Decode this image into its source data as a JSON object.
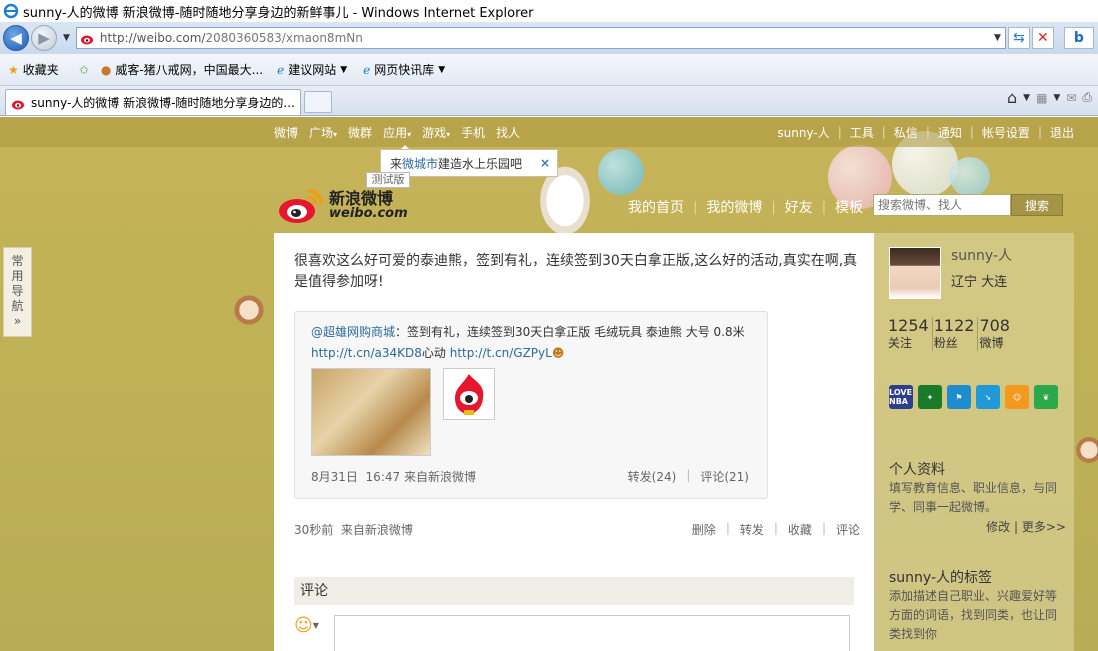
{
  "browser": {
    "window_title": "sunny-人的微博 新浪微博-随时随地分享身边的新鲜事儿 - Windows Internet Explorer",
    "url_host": "http://weibo.com/",
    "url_path": "2080360583/xmaon8mNn",
    "favorites_label": "收藏夹",
    "fav_items": [
      "威客-猪八戒网，中国最大...",
      "建议网站",
      "网页快讯库"
    ],
    "tab_title": "sunny-人的微博 新浪微博-随时随地分享身边的..."
  },
  "topnav": {
    "left": [
      "微博",
      "广场",
      "微群",
      "应用",
      "游戏",
      "手机",
      "找人"
    ],
    "right": [
      "sunny-人",
      "工具",
      "私信",
      "通知",
      "帐号设置",
      "退出"
    ]
  },
  "tip": {
    "prefix": "来",
    "link": "微城市",
    "suffix": "建造水上乐园吧",
    "close": "×"
  },
  "beta": "测试版",
  "logo": {
    "cn": "新浪微博",
    "en": "weibo.com"
  },
  "mainnav": [
    "我的首页",
    "我的微博",
    "好友",
    "模板"
  ],
  "search": {
    "placeholder": "搜索微博、找人",
    "button": "搜索"
  },
  "sidetab": [
    "常",
    "用",
    "导",
    "航",
    "»"
  ],
  "post": {
    "text": "很喜欢这么好可爱的泰迪熊，签到有礼，连续签到30天白拿正版,这么好的活动,真实在啊,真是值得参加呀!",
    "repost_author": "@超雄网购商城",
    "repost_text": "：签到有礼，连续签到30天白拿正版 毛绒玩具 泰迪熊 大号 0.8米",
    "repost_link1": "http://t.cn/a34KD8",
    "repost_mid": "心动",
    "repost_link2": "http://t.cn/GZPyL",
    "repost_date": "8月31日",
    "repost_time": "16:47",
    "repost_source": "来自新浪微博",
    "repost_forward": "转发(24)",
    "repost_comment": "评论(21)",
    "time": "30秒前",
    "source": "来自新浪微博",
    "actions": [
      "删除",
      "转发",
      "收藏",
      "评论"
    ]
  },
  "comment": {
    "title": "评论"
  },
  "profile": {
    "name": "sunny-人",
    "location": "辽宁  大连",
    "stats": [
      {
        "num": "1254",
        "label": "关注"
      },
      {
        "num": "1122",
        "label": "粉丝"
      },
      {
        "num": "708",
        "label": "微博"
      }
    ],
    "apps": [
      {
        "label": "LOVE NBA",
        "color": "#2b3f8c"
      },
      {
        "label": "",
        "color": "#1a7a2a"
      },
      {
        "label": "",
        "color": "#1c8ecf"
      },
      {
        "label": "",
        "color": "#1f9ad6"
      },
      {
        "label": "",
        "color": "#f39a1e"
      },
      {
        "label": "",
        "color": "#2ba84a"
      }
    ],
    "info_title": "个人资料",
    "info_text": "填写教育信息、职业信息，与同学、同事一起微博。",
    "info_edit": "修改",
    "info_more": "更多>>",
    "tags_title": "sunny-人的标签",
    "tags_text": "添加描述自己职业、兴趣爱好等方面的词语，找到同类，也让同类找到你"
  }
}
